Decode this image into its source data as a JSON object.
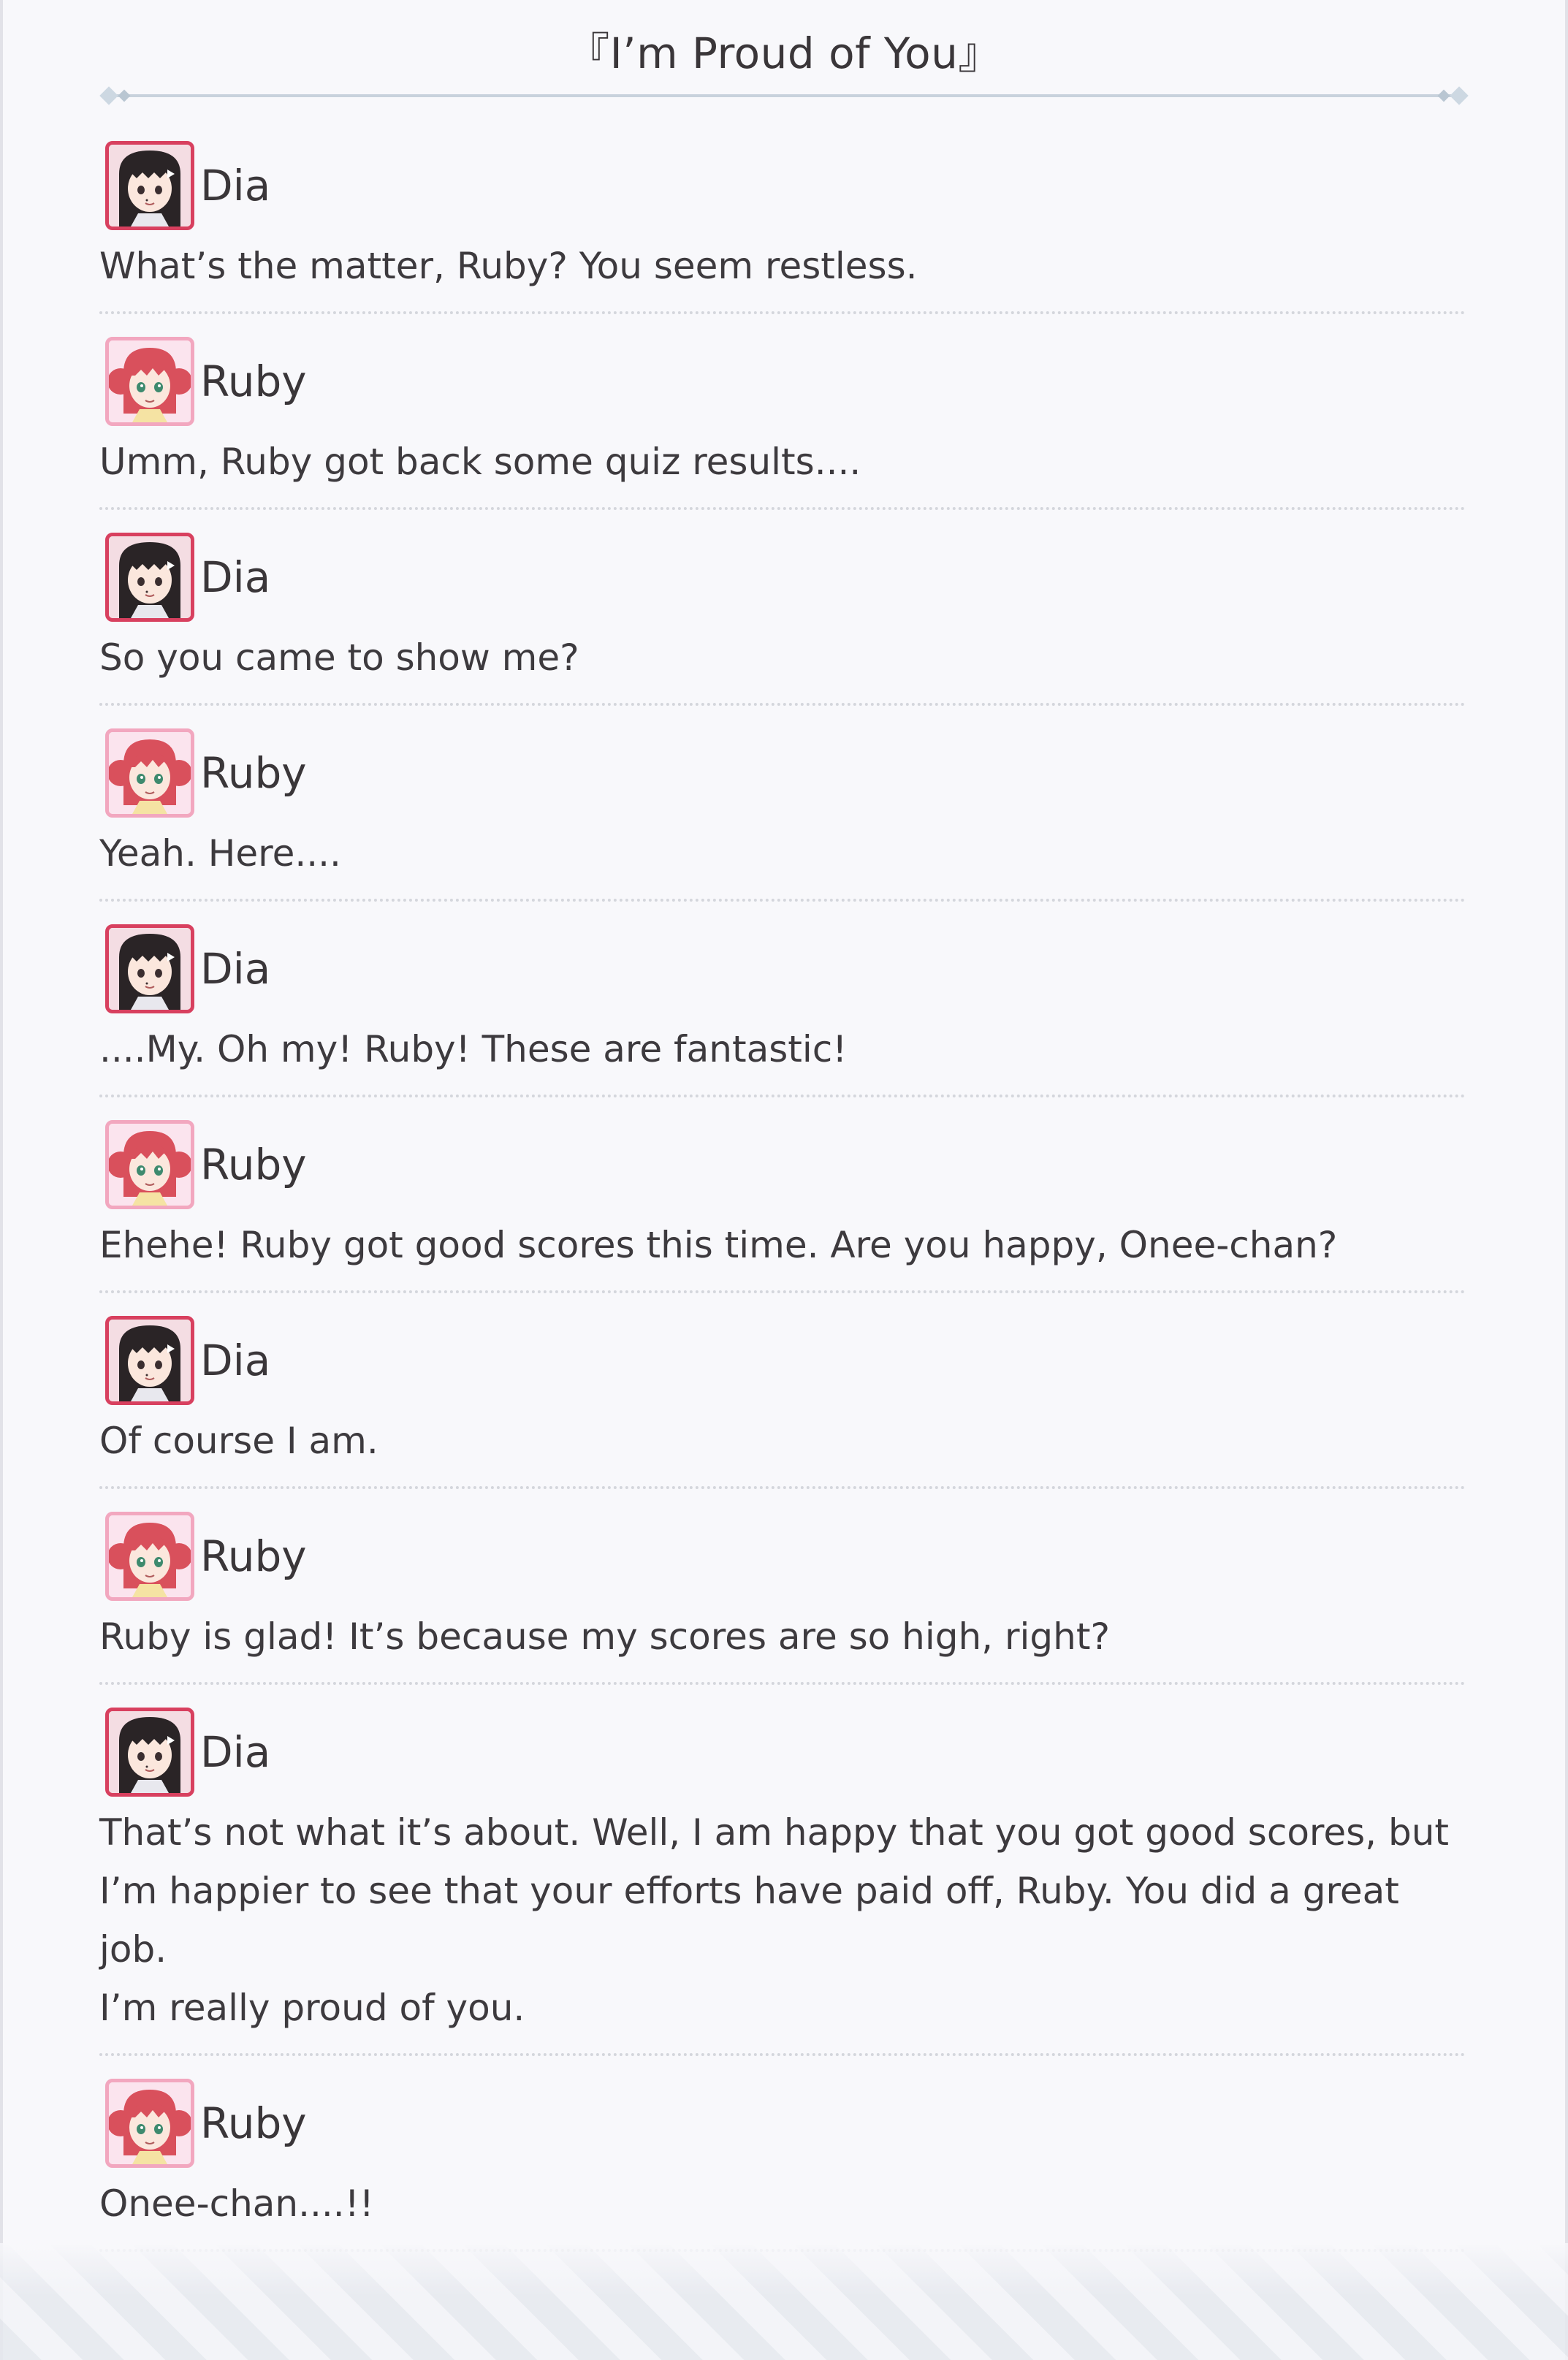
{
  "story": {
    "title": "『I’m Proud of You』"
  },
  "dialogue": [
    {
      "speaker": "Dia",
      "avatar": "dia-portrait",
      "text": "What’s the matter, Ruby? You seem restless."
    },
    {
      "speaker": "Ruby",
      "avatar": "ruby-portrait",
      "text": "Umm, Ruby got back some quiz results...."
    },
    {
      "speaker": "Dia",
      "avatar": "dia-portrait",
      "text": "So you came to show me?"
    },
    {
      "speaker": "Ruby",
      "avatar": "ruby-portrait",
      "text": "Yeah. Here...."
    },
    {
      "speaker": "Dia",
      "avatar": "dia-portrait",
      "text": "....My. Oh my! Ruby! These are fantastic!"
    },
    {
      "speaker": "Ruby",
      "avatar": "ruby-portrait",
      "text": "Ehehe! Ruby got good scores this time. Are you happy, Onee-chan?"
    },
    {
      "speaker": "Dia",
      "avatar": "dia-portrait",
      "text": "Of course I am."
    },
    {
      "speaker": "Ruby",
      "avatar": "ruby-portrait",
      "text": "Ruby is glad! It’s because my scores are so high, right?"
    },
    {
      "speaker": "Dia",
      "avatar": "dia-portrait",
      "text": "That’s not what it’s about. Well, I am happy that you got good scores, but\nI’m happier to see that your efforts have paid off, Ruby. You did a great job.\nI’m really proud of you."
    },
    {
      "speaker": "Ruby",
      "avatar": "ruby-portrait",
      "text": "Onee-chan....!!"
    }
  ],
  "colors": {
    "background": "#f8f8fb",
    "text": "#3d3a3e",
    "dia_frame": "#d8405f",
    "ruby_frame": "#f2a7bf",
    "divider": "#d4d6dc"
  }
}
